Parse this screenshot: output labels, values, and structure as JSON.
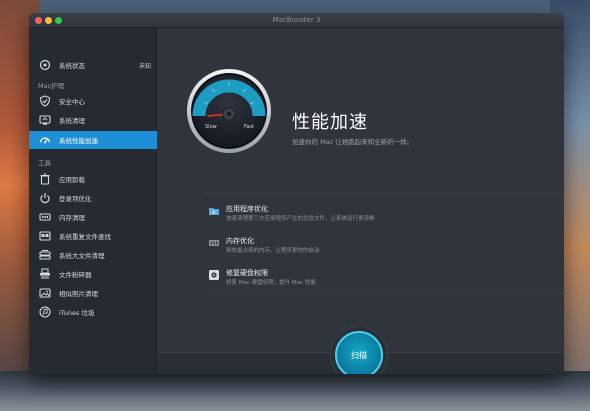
{
  "window": {
    "title": "MacBooster 3"
  },
  "sidebar": {
    "top_item": {
      "label": "系统状态",
      "status": "未知",
      "icon": "monitor-icon"
    },
    "sections": [
      {
        "title": "Mac护理",
        "items": [
          {
            "label": "安全中心",
            "icon": "shield-icon"
          },
          {
            "label": "系统清理",
            "icon": "screen-clean-icon"
          },
          {
            "label": "系统性能加速",
            "icon": "speed-gauge-icon",
            "active": true
          }
        ]
      },
      {
        "title": "工具",
        "items": [
          {
            "label": "应用卸载",
            "icon": "trash-icon"
          },
          {
            "label": "登录项优化",
            "icon": "power-icon"
          },
          {
            "label": "内存清理",
            "icon": "memory-chip-icon"
          },
          {
            "label": "系统重复文件查找",
            "icon": "duplicate-file-icon"
          },
          {
            "label": "系统大文件清理",
            "icon": "large-file-icon"
          },
          {
            "label": "文件粉碎器",
            "icon": "shredder-icon"
          },
          {
            "label": "相似照片清理",
            "icon": "photo-icon"
          },
          {
            "label": "iTunes 垃圾",
            "icon": "music-icon"
          }
        ]
      }
    ]
  },
  "main": {
    "gauge": {
      "slow_label": "Slow",
      "fast_label": "Fast"
    },
    "title": "性能加速",
    "subtitle": "加速你的 Mac 让她跑起来和全新的一样。",
    "tools": [
      {
        "name": "应用程序优化",
        "desc": "快速清理第三方应用程序产生的垃圾文件，让系统运行更流畅",
        "icon": "app-folder-icon"
      },
      {
        "name": "内存优化",
        "desc": "释放最占用的内存，让程序更快的启动",
        "icon": "ram-icon"
      },
      {
        "name": "修复硬盘权限",
        "desc": "修复 Mac 硬盘权限，提升 Mac 性能",
        "icon": "disk-repair-icon"
      }
    ],
    "scan_button": "扫描"
  },
  "colors": {
    "accent": "#1e8fd6",
    "scan": "#0c7fa3",
    "gauge_teal": "#1d9cc4",
    "needle": "#e0322c"
  }
}
